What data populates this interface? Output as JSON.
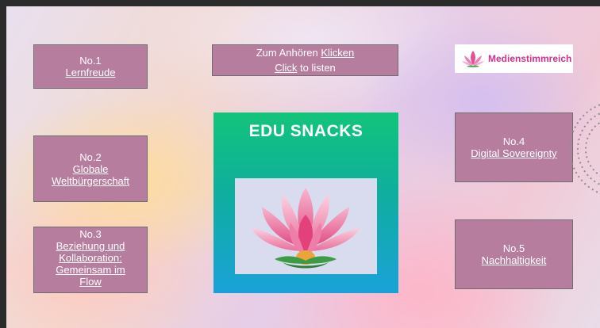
{
  "items": [
    {
      "number": "No.1",
      "link": "Lernfreude"
    },
    {
      "number": "No.2",
      "link": "Globale Weltbürgerschaft"
    },
    {
      "number": "No.3",
      "link": "Beziehung und Kollaboration: Gemeinsam im Flow"
    },
    {
      "number": "No.4",
      "link": "Digital Sovereignty"
    },
    {
      "number": "No.5",
      "link": "Nachhaltigkeit"
    }
  ],
  "listen": {
    "de_text": "Zum Anhören ",
    "de_link": "Klicken",
    "en_link": "Click",
    "en_text": " to listen"
  },
  "logo": {
    "text": "Medienstimmreich"
  },
  "center": {
    "title": "EDU SNACKS"
  },
  "colors": {
    "box": "#b67d9f",
    "logo_text": "#d2318a",
    "card_top": "#12c47a",
    "card_bottom": "#1aa2d8"
  },
  "icons": {
    "logo": "lotus-logo-icon",
    "lotus": "lotus-flower-icon",
    "dots": "dotted-circle-icon"
  }
}
